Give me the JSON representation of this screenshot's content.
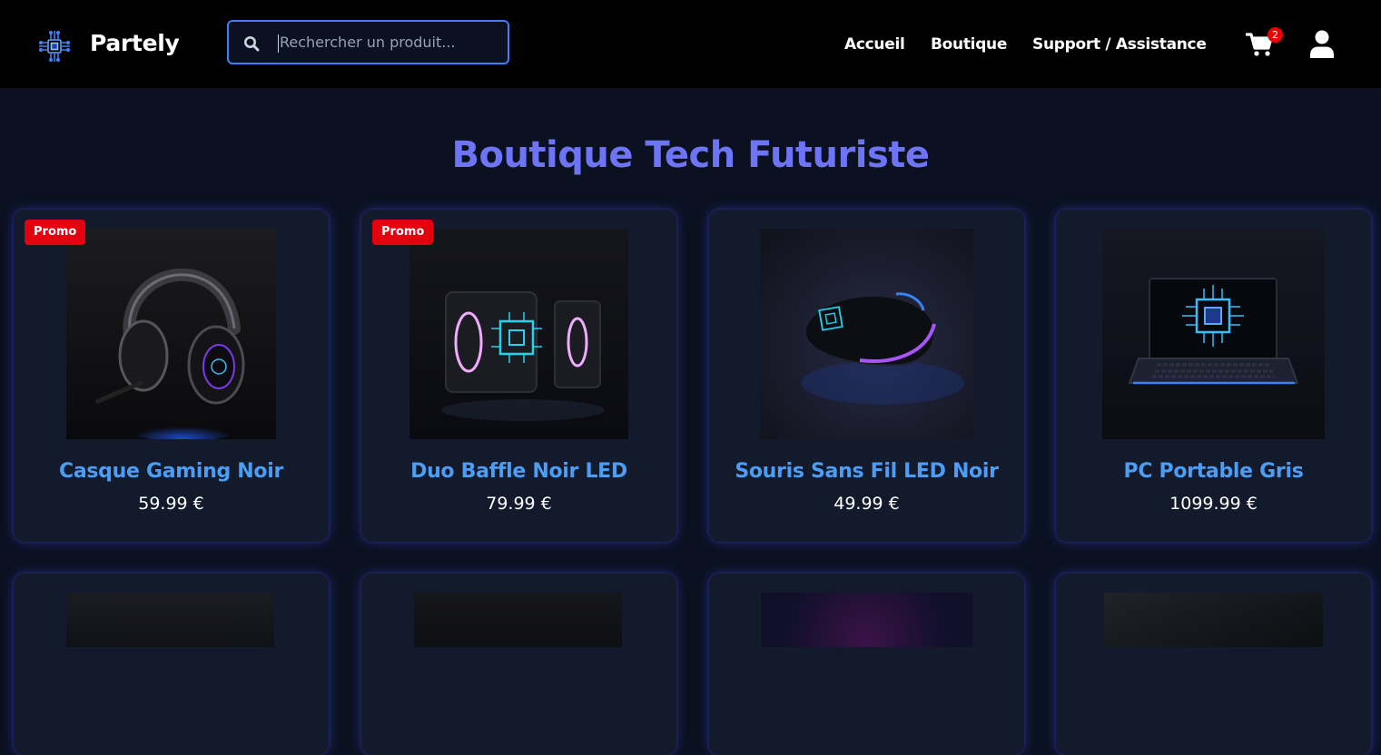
{
  "brand": {
    "name": "Partely",
    "icon": "circuit-chip-icon"
  },
  "search": {
    "placeholder": "Rechercher un produit...",
    "icon": "search-icon"
  },
  "nav": [
    {
      "label": "Accueil"
    },
    {
      "label": "Boutique"
    },
    {
      "label": "Support / Assistance"
    }
  ],
  "cart": {
    "icon": "cart-icon",
    "count": "2"
  },
  "user": {
    "icon": "user-icon"
  },
  "page": {
    "title": "Boutique Tech Futuriste"
  },
  "products": [
    {
      "name": "Casque Gaming Noir",
      "price": "59.99 €",
      "badge": "Promo",
      "image": "gaming-headset-image"
    },
    {
      "name": "Duo Baffle Noir LED",
      "price": "79.99 €",
      "badge": "Promo",
      "image": "led-speakers-image"
    },
    {
      "name": "Souris Sans Fil LED Noir",
      "price": "49.99 €",
      "badge": "",
      "image": "wireless-mouse-image"
    },
    {
      "name": "PC Portable Gris",
      "price": "1099.99 €",
      "badge": "",
      "image": "laptop-image"
    }
  ],
  "colors": {
    "accent": "#3b82f6",
    "title": "#6d74f5",
    "product_name": "#4c9df5",
    "promo": "#e3000f",
    "background": "#0b1120",
    "card": "#121a2c"
  }
}
